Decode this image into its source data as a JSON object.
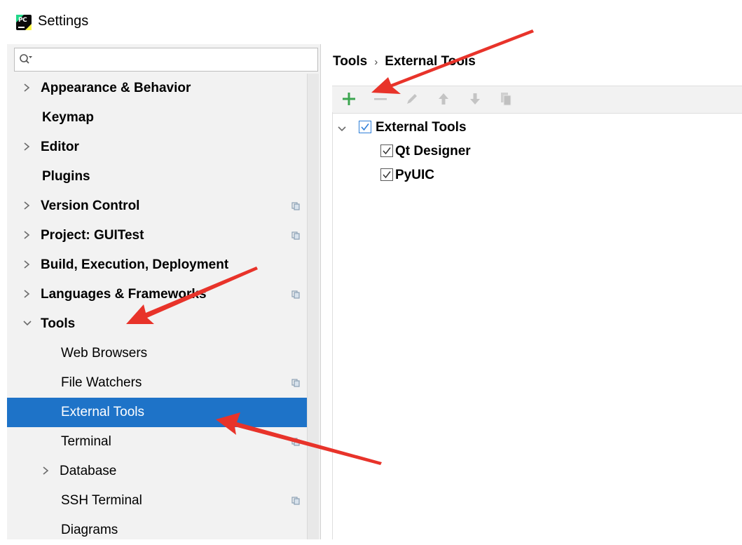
{
  "window": {
    "title": "Settings",
    "logo_text": "PC"
  },
  "search": {
    "placeholder": "",
    "value": ""
  },
  "sidebar": {
    "items": [
      {
        "label": "Appearance & Behavior",
        "bold": true,
        "arrow": "right",
        "config": false
      },
      {
        "label": "Keymap",
        "bold": true,
        "arrow": "none",
        "config": false
      },
      {
        "label": "Editor",
        "bold": true,
        "arrow": "right",
        "config": false
      },
      {
        "label": "Plugins",
        "bold": true,
        "arrow": "none",
        "config": false
      },
      {
        "label": "Version Control",
        "bold": true,
        "arrow": "right",
        "config": true
      },
      {
        "label": "Project: GUITest",
        "bold": true,
        "arrow": "right",
        "config": true
      },
      {
        "label": "Build, Execution, Deployment",
        "bold": true,
        "arrow": "right",
        "config": false
      },
      {
        "label": "Languages & Frameworks",
        "bold": true,
        "arrow": "right",
        "config": true
      },
      {
        "label": "Tools",
        "bold": true,
        "arrow": "down",
        "config": false
      },
      {
        "label": "Web Browsers",
        "bold": false,
        "arrow": "none",
        "config": false
      },
      {
        "label": "File Watchers",
        "bold": false,
        "arrow": "none",
        "config": true
      },
      {
        "label": "External Tools",
        "bold": false,
        "arrow": "none",
        "config": false,
        "selected": true
      },
      {
        "label": "Terminal",
        "bold": false,
        "arrow": "none",
        "config": true
      },
      {
        "label": "Database",
        "bold": false,
        "arrow": "right",
        "config": false
      },
      {
        "label": "SSH Terminal",
        "bold": false,
        "arrow": "none",
        "config": true
      },
      {
        "label": "Diagrams",
        "bold": false,
        "arrow": "none",
        "config": false
      }
    ]
  },
  "breadcrumb": {
    "parent": "Tools",
    "separator": "›",
    "current": "External Tools"
  },
  "toolbar": {
    "buttons": [
      {
        "name": "add",
        "icon": "plus-icon",
        "enabled": true
      },
      {
        "name": "remove",
        "icon": "minus-icon",
        "enabled": false
      },
      {
        "name": "edit",
        "icon": "pencil-icon",
        "enabled": false
      },
      {
        "name": "move-up",
        "icon": "arrow-up-icon",
        "enabled": false
      },
      {
        "name": "move-down",
        "icon": "arrow-down-icon",
        "enabled": false
      },
      {
        "name": "copy",
        "icon": "copy-icon",
        "enabled": false
      }
    ]
  },
  "external_tools": {
    "group": {
      "label": "External Tools",
      "checked": true,
      "expanded": true
    },
    "tools": [
      {
        "label": "Qt Designer",
        "checked": true
      },
      {
        "label": "PyUIC",
        "checked": true
      }
    ]
  },
  "colors": {
    "selection": "#1e73c8",
    "sidebar_bg": "#f2f2f2",
    "add_green": "#3ca550",
    "annotation_red": "#e8332a"
  }
}
